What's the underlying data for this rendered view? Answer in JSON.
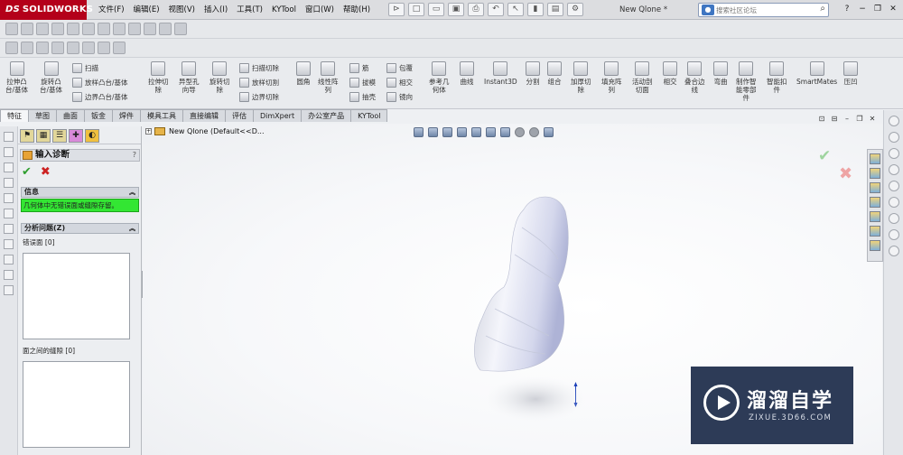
{
  "titlebar": {
    "logo_ds": "DS",
    "logo": "SOLIDWORKS",
    "menus": [
      "文件(F)",
      "编辑(E)",
      "视图(V)",
      "插入(I)",
      "工具(T)",
      "KYTool",
      "窗口(W)",
      "帮助(H)"
    ],
    "document_title": "New Qlone *",
    "search_placeholder": "搜索社区论坛",
    "help": "?"
  },
  "command_manager": {
    "extrude_boss": "拉伸凸\n台/基体",
    "revolve_boss": "旋转凸\n台/基体",
    "sweep": "扫描",
    "loft": "放样凸台/基体",
    "boundary_boss": "边界凸台/基体",
    "extrude_cut": "拉伸切\n除",
    "hole_wizard": "异型孔\n向导",
    "revolve_cut": "旋转切\n除",
    "swept_cut": "扫描切除",
    "lofted_cut": "放样切割",
    "boundary_cut": "边界切除",
    "fillet": "圆角",
    "linear_pattern": "线性阵\n列",
    "rib": "筋",
    "draft": "拔模",
    "shell": "抽壳",
    "wrap": "包覆",
    "intersect": "相交",
    "mirror": "镜向",
    "ref_geometry": "参考几\n何体",
    "curves": "曲线",
    "instant3d": "Instant3D",
    "split": "分割",
    "combine": "组合",
    "thicken_cut": "加厚切\n除",
    "fill_pattern": "填充阵\n列",
    "active_cut": "活动剖\n切面",
    "intersect2": "相交",
    "fit_edge": "叠合边\n线",
    "flex": "弯曲",
    "smart_part": "制作智\n能零部\n件",
    "smart_fastener": "智能扣\n件",
    "smartmates": "SmartMates",
    "compress": "压凹"
  },
  "tabs": [
    "特征",
    "草图",
    "曲面",
    "钣金",
    "焊件",
    "模具工具",
    "直接编辑",
    "评估",
    "DimXpert",
    "办公室产品",
    "KYTool"
  ],
  "property_manager": {
    "title": "输入诊断",
    "help": "?",
    "info_group": "信息",
    "message": "几何体中无错误面或缝隙存留。",
    "analyze_group": "分析问题(Z)",
    "faulty_faces_label": "错误面",
    "faulty_faces_count": "[0]",
    "gaps_label": "面之间的缝隙",
    "gaps_count": "[0]"
  },
  "viewport": {
    "tree_item": "New Qlone  (Default<<D..."
  },
  "watermark": {
    "cn": "溜溜自学",
    "en": "ZIXUE.3D66.COM"
  },
  "colors": {
    "logo_bg": "#b4001a",
    "message_bg": "#33e633",
    "watermark_bg": "#2d3b57",
    "model": "#e4e6f2"
  }
}
